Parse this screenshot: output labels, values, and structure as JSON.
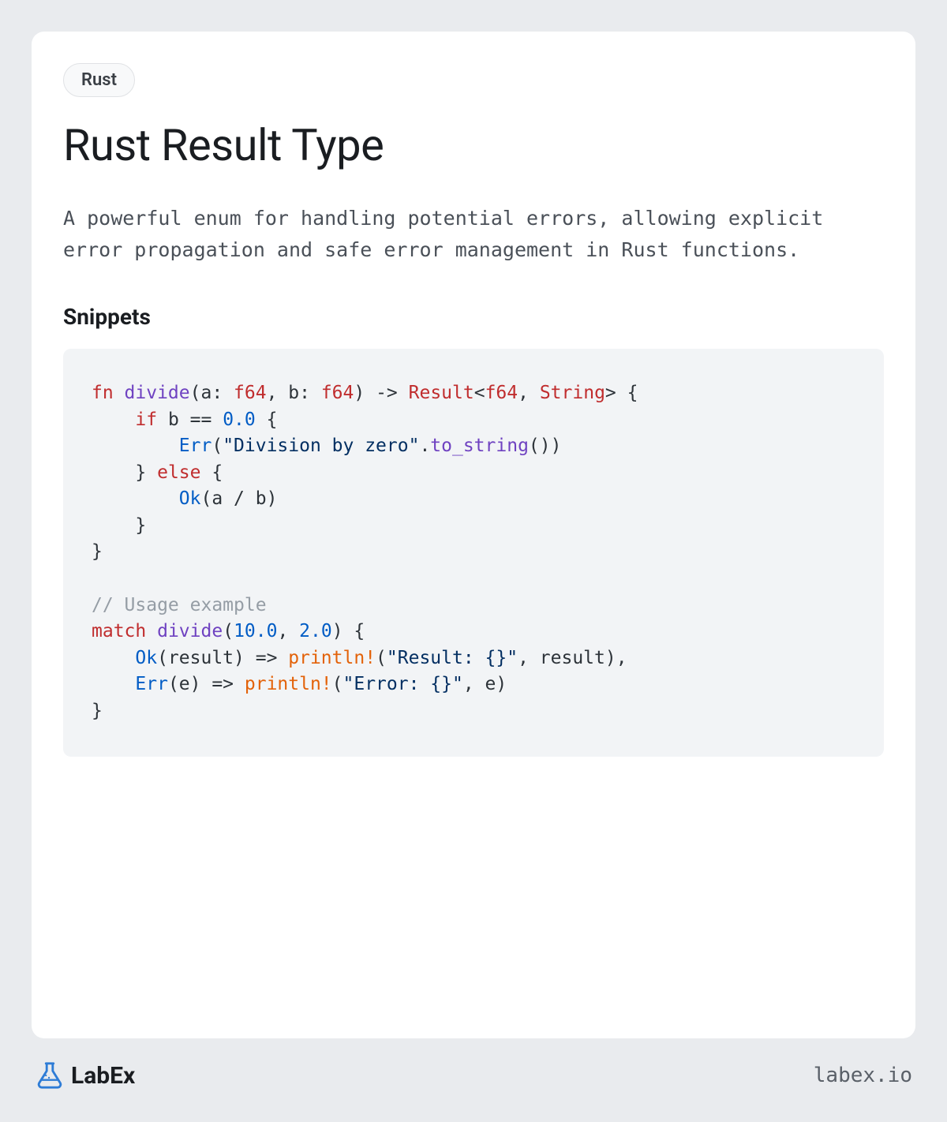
{
  "tag": "Rust",
  "title": "Rust Result Type",
  "description": "A powerful enum for handling potential errors, allowing explicit error propagation and safe error management in Rust functions.",
  "snippets_heading": "Snippets",
  "code": {
    "tokens": [
      {
        "t": "fn ",
        "c": "kw-fn"
      },
      {
        "t": "divide",
        "c": "ident"
      },
      {
        "t": "(a: "
      },
      {
        "t": "f64",
        "c": "type"
      },
      {
        "t": ", b: "
      },
      {
        "t": "f64",
        "c": "type"
      },
      {
        "t": ") -> "
      },
      {
        "t": "Result",
        "c": "type"
      },
      {
        "t": "<"
      },
      {
        "t": "f64",
        "c": "type"
      },
      {
        "t": ", "
      },
      {
        "t": "String",
        "c": "type"
      },
      {
        "t": "> {\n"
      },
      {
        "t": "    "
      },
      {
        "t": "if",
        "c": "kw-fn"
      },
      {
        "t": " b == "
      },
      {
        "t": "0.0",
        "c": "num"
      },
      {
        "t": " {\n"
      },
      {
        "t": "        "
      },
      {
        "t": "Err",
        "c": "variant"
      },
      {
        "t": "("
      },
      {
        "t": "\"Division by zero\"",
        "c": "str"
      },
      {
        "t": "."
      },
      {
        "t": "to_string",
        "c": "method"
      },
      {
        "t": "())\n"
      },
      {
        "t": "    } "
      },
      {
        "t": "else",
        "c": "kw-fn"
      },
      {
        "t": " {\n"
      },
      {
        "t": "        "
      },
      {
        "t": "Ok",
        "c": "variant"
      },
      {
        "t": "(a / b)\n"
      },
      {
        "t": "    }\n"
      },
      {
        "t": "}\n"
      },
      {
        "t": "\n"
      },
      {
        "t": "// Usage example\n",
        "c": "comment"
      },
      {
        "t": "match",
        "c": "kw-fn"
      },
      {
        "t": " "
      },
      {
        "t": "divide",
        "c": "ident"
      },
      {
        "t": "("
      },
      {
        "t": "10.0",
        "c": "num"
      },
      {
        "t": ", "
      },
      {
        "t": "2.0",
        "c": "num"
      },
      {
        "t": ") {\n"
      },
      {
        "t": "    "
      },
      {
        "t": "Ok",
        "c": "variant"
      },
      {
        "t": "(result) => "
      },
      {
        "t": "println!",
        "c": "macro"
      },
      {
        "t": "("
      },
      {
        "t": "\"Result: {}\"",
        "c": "str"
      },
      {
        "t": ", result),\n"
      },
      {
        "t": "    "
      },
      {
        "t": "Err",
        "c": "variant"
      },
      {
        "t": "(e) => "
      },
      {
        "t": "println!",
        "c": "macro"
      },
      {
        "t": "("
      },
      {
        "t": "\"Error: {}\"",
        "c": "str"
      },
      {
        "t": ", e)\n"
      },
      {
        "t": "}"
      }
    ]
  },
  "logo_text": "LabEx",
  "footer_url": "labex.io",
  "colors": {
    "page_bg": "#e9ebee",
    "card_bg": "#ffffff",
    "code_bg": "#f2f4f6",
    "accent_blue": "#2e7cd6"
  }
}
